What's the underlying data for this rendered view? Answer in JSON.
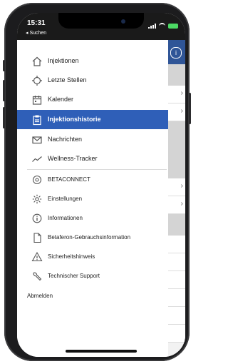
{
  "status_bar": {
    "time": "15:31",
    "back_app": "◂ Suchen"
  },
  "menu": {
    "items": [
      {
        "label": "Injektionen",
        "icon": "home-icon"
      },
      {
        "label": "Letzte Stellen",
        "icon": "target-icon"
      },
      {
        "label": "Kalender",
        "icon": "calendar-icon"
      },
      {
        "label": "Injektionshistorie",
        "icon": "clipboard-icon",
        "active": true
      },
      {
        "label": "Nachrichten",
        "icon": "mail-icon"
      },
      {
        "label": "Wellness-Tracker",
        "icon": "trend-icon"
      }
    ],
    "secondary": [
      {
        "label": "BETACONNECT",
        "icon": "device-icon"
      },
      {
        "label": "Einstellungen",
        "icon": "gear-icon"
      },
      {
        "label": "Informationen",
        "icon": "info-icon"
      },
      {
        "label": "Betaferon-Gebrauchsinformation",
        "icon": "document-icon"
      },
      {
        "label": "Sicherheitshinweis",
        "icon": "warning-icon"
      },
      {
        "label": "Technischer Support",
        "icon": "wrench-icon"
      }
    ],
    "logout": "Abmelden"
  },
  "colors": {
    "accent": "#2f5fb8",
    "header": "#2f5597"
  }
}
